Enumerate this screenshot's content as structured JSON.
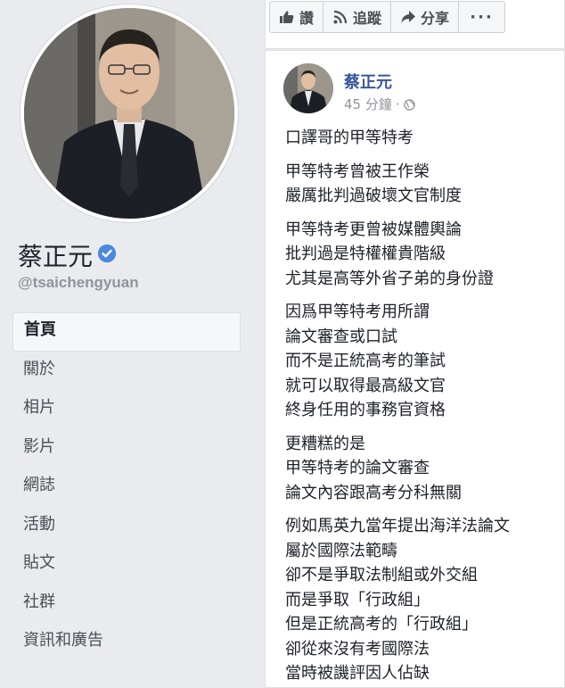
{
  "profile": {
    "name": "蔡正元",
    "handle": "@tsaichengyuan"
  },
  "nav": [
    {
      "label": "首頁",
      "active": true
    },
    {
      "label": "關於"
    },
    {
      "label": "相片"
    },
    {
      "label": "影片"
    },
    {
      "label": "網誌"
    },
    {
      "label": "活動"
    },
    {
      "label": "貼文"
    },
    {
      "label": "社群"
    },
    {
      "label": "資訊和廣告"
    }
  ],
  "actions": {
    "like": "讚",
    "follow": "追蹤",
    "share": "分享",
    "more": "···"
  },
  "post": {
    "author": "蔡正元",
    "time": "45 分鐘",
    "paragraphs": [
      [
        "口譯哥的甲等特考"
      ],
      [
        "甲等特考曾被王作榮",
        "嚴厲批判過破壞文官制度"
      ],
      [
        "甲等特考更曾被媒體輿論",
        "批判過是特權權貴階級",
        "尤其是高等外省子弟的身份證"
      ],
      [
        "因爲甲等特考用所謂",
        "論文審查或口試",
        "而不是正統高考的筆試",
        "就可以取得最高級文官",
        "終身任用的事務官資格"
      ],
      [
        "更糟糕的是",
        "甲等特考的論文審查",
        "論文內容跟高考分科無關"
      ],
      [
        "例如馬英九當年提出海洋法論文",
        "屬於國際法範疇",
        "卻不是爭取法制組或外交組",
        "而是爭取「行政組」",
        "但是正統高考的「行政組」",
        "卻從來沒有考國際法",
        "當時被譏評因人佔缺"
      ]
    ]
  },
  "colors": {
    "background": "#e9ebee",
    "link": "#365899",
    "verified": "#4a89dc",
    "muted": "#90949c"
  }
}
